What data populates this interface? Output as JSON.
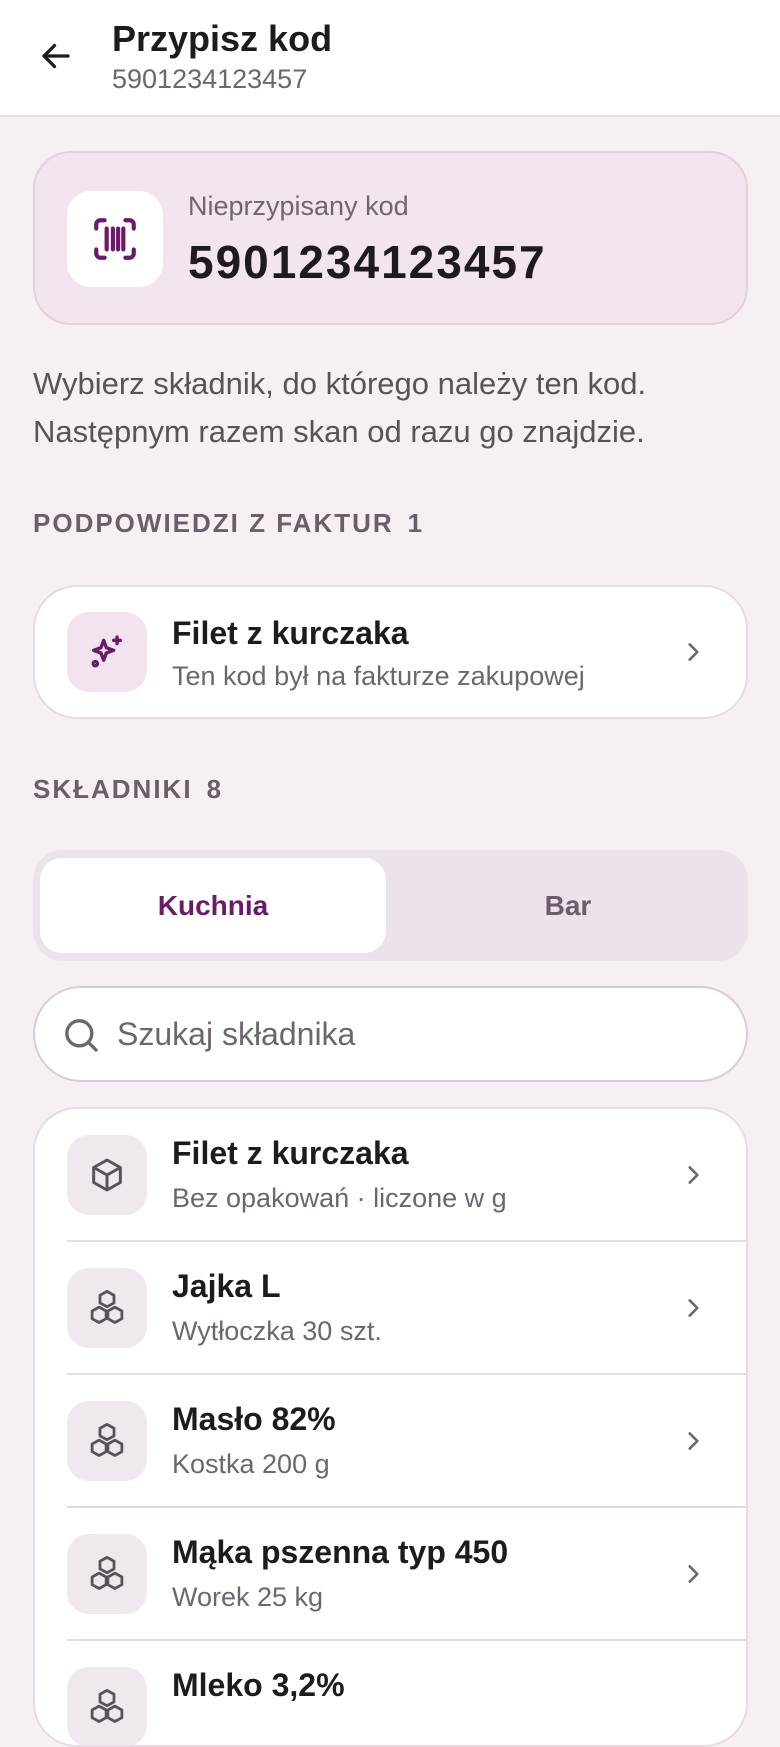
{
  "header": {
    "title": "Przypisz kod",
    "subtitle": "5901234123457"
  },
  "code_card": {
    "label": "Nieprzypisany kod",
    "value": "5901234123457"
  },
  "helper_text": "Wybierz składnik, do którego należy ten kod. Następnym razem skan od razu go znajdzie.",
  "suggestions": {
    "heading": "PODPOWIEDZI Z FAKTUR",
    "count": "1",
    "items": [
      {
        "title": "Filet z kurczaka",
        "subtitle": "Ten kod był na fakturze zakupowej",
        "icon": "sparkle-icon"
      }
    ]
  },
  "ingredients": {
    "heading": "SKŁADNIKI",
    "count": "8",
    "tabs": [
      {
        "label": "Kuchnia",
        "active": true
      },
      {
        "label": "Bar",
        "active": false
      }
    ],
    "search_placeholder": "Szukaj składnika",
    "items": [
      {
        "title": "Filet z kurczaka",
        "subtitle": "Bez opakowań · liczone w g",
        "icon": "box-icon"
      },
      {
        "title": "Jajka L",
        "subtitle": "Wytłoczka 30 szt.",
        "icon": "boxes-icon"
      },
      {
        "title": "Masło 82%",
        "subtitle": "Kostka 200 g",
        "icon": "boxes-icon"
      },
      {
        "title": "Mąka pszenna typ 450",
        "subtitle": "Worek 25 kg",
        "icon": "boxes-icon"
      },
      {
        "title": "Mleko 3,2%",
        "subtitle": "",
        "icon": "boxes-icon"
      }
    ]
  },
  "colors": {
    "accent": "#6b1a69",
    "background": "#f6f0f5",
    "code_card_bg": "#f3e5ef"
  }
}
